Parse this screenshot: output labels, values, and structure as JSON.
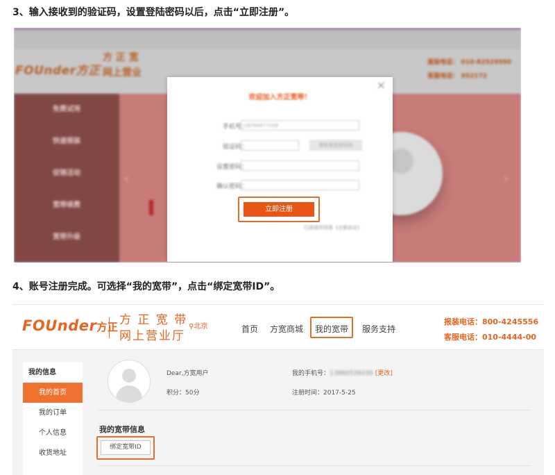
{
  "steps": {
    "step3": "3、输入接收到的验证码，设置登陆密码以后，点击“立即注册”。",
    "step4": "4、账号注册完成。可选择“我的宽带”，点击“绑定宽带ID”。"
  },
  "shot1": {
    "logo": "FOUnder方正",
    "brand_line1": "方 正 宽",
    "brand_line2": "网上营业",
    "hotline": "报装电话：  010-82529990",
    "service": "客服电话：  952172",
    "sidebar": [
      "免费试用",
      "快速报装",
      "促销活动",
      "宽带续费",
      "宽带升级"
    ],
    "modal": {
      "title": "欢迎加入方正宽带！",
      "close": "×",
      "phone_label": "手机号：",
      "phone_value": "18766677009",
      "code_label": "验证码：",
      "code_button": "重新发送验证码",
      "password_label": "设置密码：",
      "confirm_label": "确认密码：",
      "register_button": "立即注册",
      "agreement": "已阅读并同意《注册协议》"
    }
  },
  "shot2": {
    "logo": "FOUnder",
    "logo_cn": "方正",
    "brand_line1": "方 正 宽 带",
    "brand_line2": "网上营业厅",
    "location": "北京",
    "nav": [
      "首页",
      "方宽商城",
      "我的宽带",
      "服务支持"
    ],
    "hotline_label": "报装电话：",
    "hotline_value": "800-4245556",
    "service_label": "客服电话：",
    "service_value": "010-4444-00",
    "sidebar": {
      "header": "我的信息",
      "items": [
        "我的首页",
        "我的订单",
        "个人信息",
        "收货地址"
      ]
    },
    "profile": {
      "greeting": "Dear,方宽用户",
      "points": "积分：50分",
      "phone_label": "我的手机号：",
      "phone_value": "13860526030",
      "change_link": "[更改]",
      "register_time": "注册时间：2017-5-25"
    },
    "broadband_section": "我的宽带信息",
    "bind_button": "绑定宽带ID"
  }
}
